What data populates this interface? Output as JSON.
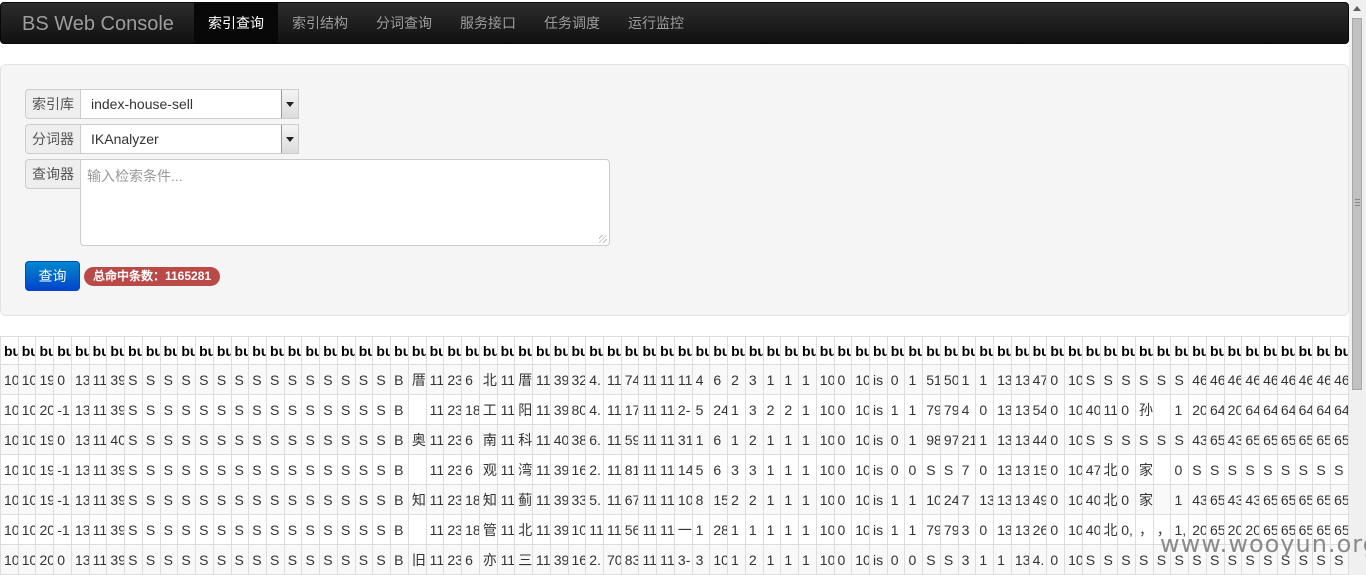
{
  "app": {
    "brand": "BS Web Console"
  },
  "nav": [
    {
      "label": "索引查询",
      "active": true
    },
    {
      "label": "索引结构",
      "active": false
    },
    {
      "label": "分词查询",
      "active": false
    },
    {
      "label": "服务接口",
      "active": false
    },
    {
      "label": "任务调度",
      "active": false
    },
    {
      "label": "运行监控",
      "active": false
    }
  ],
  "form": {
    "index_label": "索引库",
    "index_value": "index-house-sell",
    "analyzer_label": "分词器",
    "analyzer_value": "IKAnalyzer",
    "query_label": "查询器",
    "query_placeholder": "输入检索条件...",
    "query_button": "查询",
    "hits_badge": "总命中条数：1165281"
  },
  "table": {
    "headers": [
      "bu",
      "bu",
      "bu",
      "buil",
      "bui",
      "bu",
      "bu",
      "bu",
      "bu",
      "bu",
      "bu",
      "bu",
      "bu",
      "bu",
      "bu",
      "bu",
      "bu",
      "bu",
      "bu",
      "bu",
      "bu",
      "bu",
      "bu",
      "bu",
      "bu",
      "bu",
      "bu",
      "bu",
      "bu",
      "bu",
      "bu",
      "bu",
      "bu",
      "bu",
      "bu",
      "bu",
      "bu",
      "bu",
      "bu",
      "bu",
      "bu",
      "bu",
      "bu",
      "bu",
      "bu",
      "bu",
      "bu",
      "bu",
      "bu",
      "bu",
      "bu",
      "bu",
      "bu",
      "bu",
      "bu",
      "bu",
      "bu",
      "bu",
      "bu",
      "bu",
      "bu",
      "bu",
      "bu",
      "bu",
      "bu",
      "bu",
      "bu",
      "bu",
      "bu",
      "bu",
      "bu",
      "bu",
      "bu",
      "bu",
      "bu",
      "bu"
    ],
    "rows": [
      [
        "10",
        "10",
        "19",
        "0",
        "13",
        "11",
        "39",
        "S",
        "S",
        "S",
        "S",
        "S",
        "S",
        "S",
        "S",
        "S",
        "S",
        "S",
        "S",
        "S",
        "S",
        "S",
        "B",
        "厝",
        "11",
        "23",
        "6",
        "北",
        "11",
        "厝",
        "11",
        "39",
        "32",
        "4.",
        "11",
        "74",
        "11",
        "11",
        "11",
        "4",
        "6",
        "2",
        "3",
        "1",
        "1",
        "1",
        "10",
        "0",
        "10",
        "is",
        "0",
        "1",
        "51",
        "50",
        "1",
        "1",
        "13",
        "13",
        "47",
        "0",
        "10",
        "S",
        "S",
        "S",
        "S",
        "S",
        "S",
        "46",
        "46",
        "46",
        "46",
        "46",
        "46",
        "46",
        "46",
        "46"
      ],
      [
        "10",
        "10",
        "20",
        "-1",
        "13",
        "11",
        "39",
        "S",
        "S",
        "S",
        "S",
        "S",
        "S",
        "S",
        "S",
        "S",
        "S",
        "S",
        "S",
        "S",
        "S",
        "S",
        "B",
        "",
        "11",
        "23",
        "18",
        "工",
        "11",
        "阳",
        "11",
        "39",
        "80",
        "4.",
        "11",
        "17",
        "11",
        "11",
        "2-",
        "5",
        "24",
        "1",
        "3",
        "2",
        "2",
        "1",
        "10",
        "0",
        "10",
        "is",
        "1",
        "1",
        "79",
        "79",
        "4",
        "0",
        "13",
        "13",
        "54",
        "0",
        "10",
        "40",
        "11",
        "0",
        "孙",
        "",
        "1",
        "20",
        "64",
        "20",
        "64",
        "64",
        "64",
        "64",
        "64",
        "64"
      ],
      [
        "10",
        "10",
        "19",
        "0",
        "13",
        "11",
        "40",
        "S",
        "S",
        "S",
        "S",
        "S",
        "S",
        "S",
        "S",
        "S",
        "S",
        "S",
        "S",
        "S",
        "S",
        "S",
        "B",
        "奥",
        "11",
        "23",
        "6",
        "南",
        "11",
        "科",
        "11",
        "40",
        "38",
        "6.",
        "11",
        "59",
        "11",
        "11",
        "31",
        "1",
        "6",
        "1",
        "2",
        "1",
        "1",
        "1",
        "10",
        "0",
        "10",
        "is",
        "0",
        "1",
        "98",
        "97",
        "21",
        "1",
        "13",
        "13",
        "44",
        "0",
        "10",
        "S",
        "S",
        "S",
        "S",
        "S",
        "S",
        "43",
        "65",
        "43",
        "65",
        "65",
        "65",
        "65",
        "65",
        "65"
      ],
      [
        "10",
        "10",
        "19",
        "-1",
        "13",
        "11",
        "39",
        "S",
        "S",
        "S",
        "S",
        "S",
        "S",
        "S",
        "S",
        "S",
        "S",
        "S",
        "S",
        "S",
        "S",
        "S",
        "B",
        "",
        "11",
        "23",
        "6",
        "观",
        "11",
        "湾",
        "11",
        "39",
        "16",
        "2.",
        "11",
        "81",
        "11",
        "11",
        "14",
        "5",
        "6",
        "3",
        "3",
        "1",
        "1",
        "1",
        "10",
        "0",
        "10",
        "is",
        "0",
        "0",
        "S",
        "S",
        "7",
        "0",
        "13",
        "13",
        "15",
        "0",
        "10",
        "47",
        "北",
        "0",
        "家",
        "",
        "0",
        "S",
        "S",
        "S",
        "S",
        "S",
        "S",
        "S",
        "S",
        "S"
      ],
      [
        "10",
        "10",
        "19",
        "-1",
        "13",
        "11",
        "39",
        "S",
        "S",
        "S",
        "S",
        "S",
        "S",
        "S",
        "S",
        "S",
        "S",
        "S",
        "S",
        "S",
        "S",
        "S",
        "B",
        "知",
        "11",
        "23",
        "18",
        "知",
        "11",
        "蓟",
        "11",
        "39",
        "33",
        "5.",
        "11",
        "67",
        "11",
        "11",
        "10",
        "8",
        "15",
        "2",
        "2",
        "1",
        "1",
        "1",
        "10",
        "0",
        "10",
        "is",
        "1",
        "1",
        "10",
        "24",
        "7",
        "13",
        "13",
        "13",
        "49",
        "0",
        "10",
        "40",
        "北",
        "0",
        "家",
        "",
        "1",
        "43",
        "65",
        "43",
        "43",
        "65",
        "65",
        "65",
        "65",
        "65"
      ],
      [
        "10",
        "10",
        "20",
        "-1",
        "13",
        "11",
        "39",
        "S",
        "S",
        "S",
        "S",
        "S",
        "S",
        "S",
        "S",
        "S",
        "S",
        "S",
        "S",
        "S",
        "S",
        "S",
        "B",
        "",
        "11",
        "23",
        "18",
        "管",
        "11",
        "北",
        "11",
        "39",
        "10",
        "11",
        "11",
        "56",
        "11",
        "11",
        "一",
        "1",
        "28",
        "1",
        "1",
        "1",
        "1",
        "1",
        "10",
        "0",
        "10",
        "is",
        "1",
        "1",
        "79",
        "79",
        "3",
        "0",
        "13",
        "13",
        "26",
        "0",
        "10",
        "40",
        "北",
        "0,",
        "，",
        "，",
        "1,",
        "20",
        "65",
        "20",
        "20",
        "65",
        "65",
        "65",
        "65",
        "65"
      ],
      [
        "10",
        "10",
        "20",
        "0",
        "13",
        "11",
        "39",
        "S",
        "S",
        "S",
        "S",
        "S",
        "S",
        "S",
        "S",
        "S",
        "S",
        "S",
        "S",
        "S",
        "S",
        "S",
        "B",
        "旧",
        "11",
        "23",
        "6",
        "亦",
        "11",
        "三",
        "11",
        "39",
        "16",
        "2.",
        "70",
        "83",
        "11",
        "11",
        "3-",
        "3",
        "10",
        "1",
        "2",
        "1",
        "1",
        "1",
        "10",
        "0",
        "10",
        "is",
        "0",
        "0",
        "S",
        "S",
        "3",
        "1",
        "1",
        "13",
        "4.",
        "0",
        "10",
        "S",
        "S",
        "S",
        "S",
        "S",
        "S",
        "S",
        "S",
        "S",
        "S",
        "S",
        "S",
        "S",
        "S",
        "S"
      ]
    ]
  },
  "watermark": "www.wooyun.org"
}
